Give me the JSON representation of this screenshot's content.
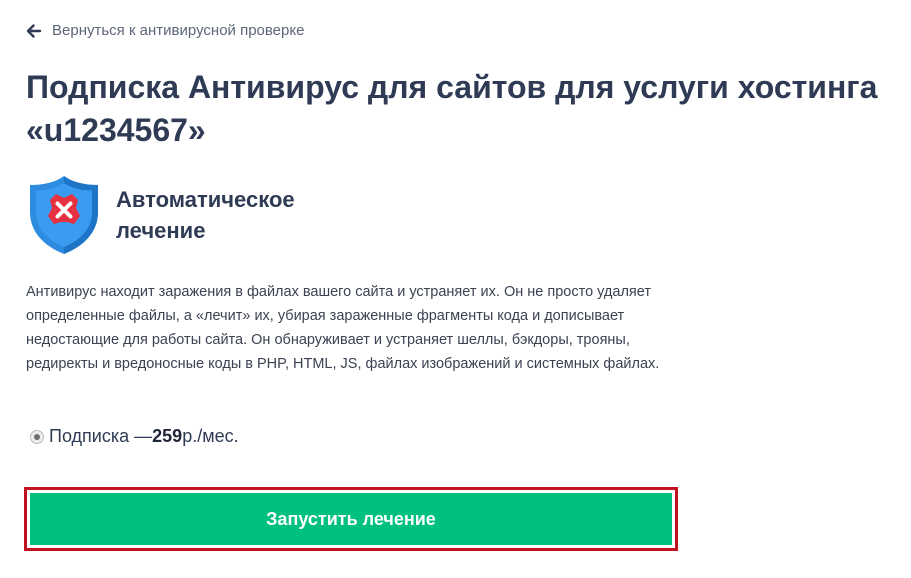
{
  "nav": {
    "back_label": "Вернуться к антивирусной проверке",
    "back_icon": "arrow-left-icon"
  },
  "header": {
    "title": "Подписка Антивирус для сайтов для услуги хостинга «u1234567»"
  },
  "feature": {
    "icon": "shield-x-icon",
    "title_line1": "Автоматическое",
    "title_line2": "лечение",
    "colors": {
      "shield": "#2d8be0",
      "badge": "#e8303f"
    }
  },
  "description": "Антивирус находит заражения в файлах вашего сайта и устраняет их. Он не просто удаляет определенные файлы, а «лечит» их, убирая зараженные фрагменты кода и дописывает недостающие для работы сайта. Он обнаруживает и устраняет шеллы, бэкдоры, трояны, редиректы и вредоносные коды в PHP, HTML, JS, файлах изображений и системных файлах.",
  "subscription": {
    "label": "Подписка —",
    "price": "259",
    "unit": " р./мес.",
    "selected": true
  },
  "action": {
    "button_label": "Запустить лечение",
    "button_color": "#00c07e",
    "highlight_color": "#c1121f"
  }
}
